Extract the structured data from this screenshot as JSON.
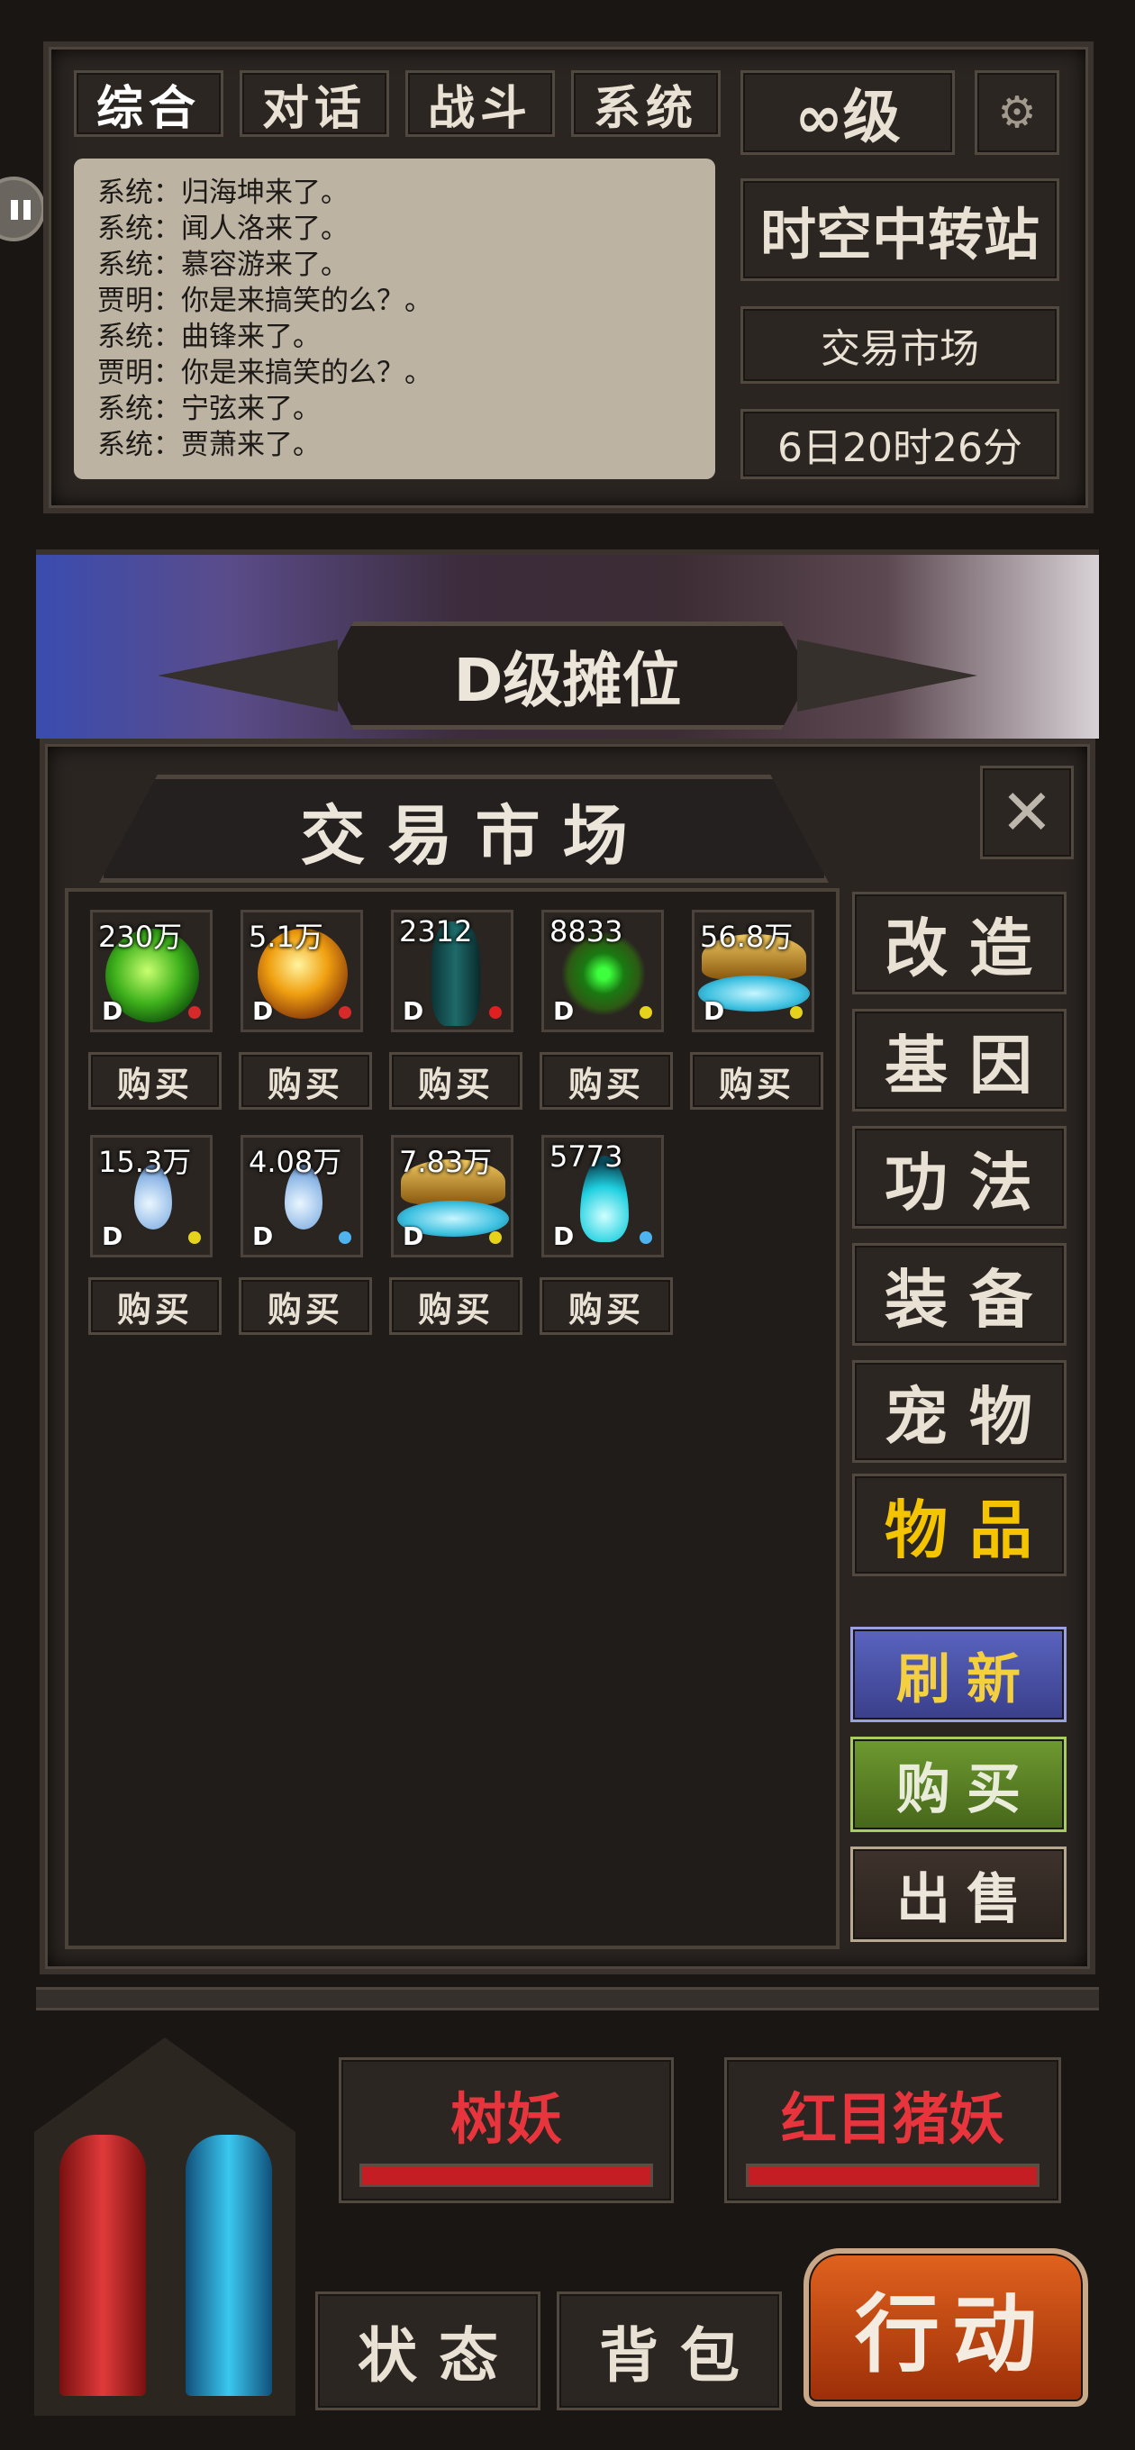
{
  "chat_tabs": [
    "综合",
    "对话",
    "战斗",
    "系统"
  ],
  "level": "∞级",
  "chat_lines": [
    "系统：归海坤来了。",
    "系统：闻人洛来了。",
    "系统：慕容游来了。",
    "贾明：你是来搞笑的么？。",
    "系统：曲锋来了。",
    "贾明：你是来搞笑的么？。",
    "系统：宁弦来了。",
    "系统：贾萧来了。"
  ],
  "location": "时空中转站",
  "place": "交易市场",
  "time": "6日20时26分",
  "banner": "D级摊位",
  "panel_title": "交 易 市 场",
  "items": [
    {
      "count": "230万",
      "grade": "D",
      "icon": "green-orb-icon",
      "color": "#d62a2a"
    },
    {
      "count": "5.1万",
      "grade": "D",
      "icon": "gold-orb-icon",
      "color": "#d62a2a"
    },
    {
      "count": "2312",
      "grade": "D",
      "icon": "vase-icon",
      "color": "#e02020"
    },
    {
      "count": "8833",
      "grade": "D",
      "icon": "jade-flower-icon",
      "color": "#e6d21a"
    },
    {
      "count": "56.8万",
      "grade": "D",
      "icon": "gold-bowl-icon",
      "color": "#e6d21a"
    },
    {
      "count": "15.3万",
      "grade": "D",
      "icon": "water-drop-icon",
      "color": "#e6d21a"
    },
    {
      "count": "4.08万",
      "grade": "D",
      "icon": "water-drop-icon",
      "color": "#4fb3f0"
    },
    {
      "count": "7.83万",
      "grade": "D",
      "icon": "gold-bowl-icon",
      "color": "#e6d21a"
    },
    {
      "count": "5773",
      "grade": "D",
      "icon": "cyan-flame-icon",
      "color": "#4fb3f0"
    }
  ],
  "buy_label": "购买",
  "categories": [
    "改造",
    "基因",
    "功法",
    "装备",
    "宠物",
    "物品"
  ],
  "selected_category": "物品",
  "actions": {
    "refresh": "刷新",
    "buy": "购买",
    "sell": "出售"
  },
  "enemies": [
    "树妖",
    "红目猪妖"
  ],
  "bottom": {
    "status": "状态",
    "bag": "背包",
    "action": "行动"
  }
}
